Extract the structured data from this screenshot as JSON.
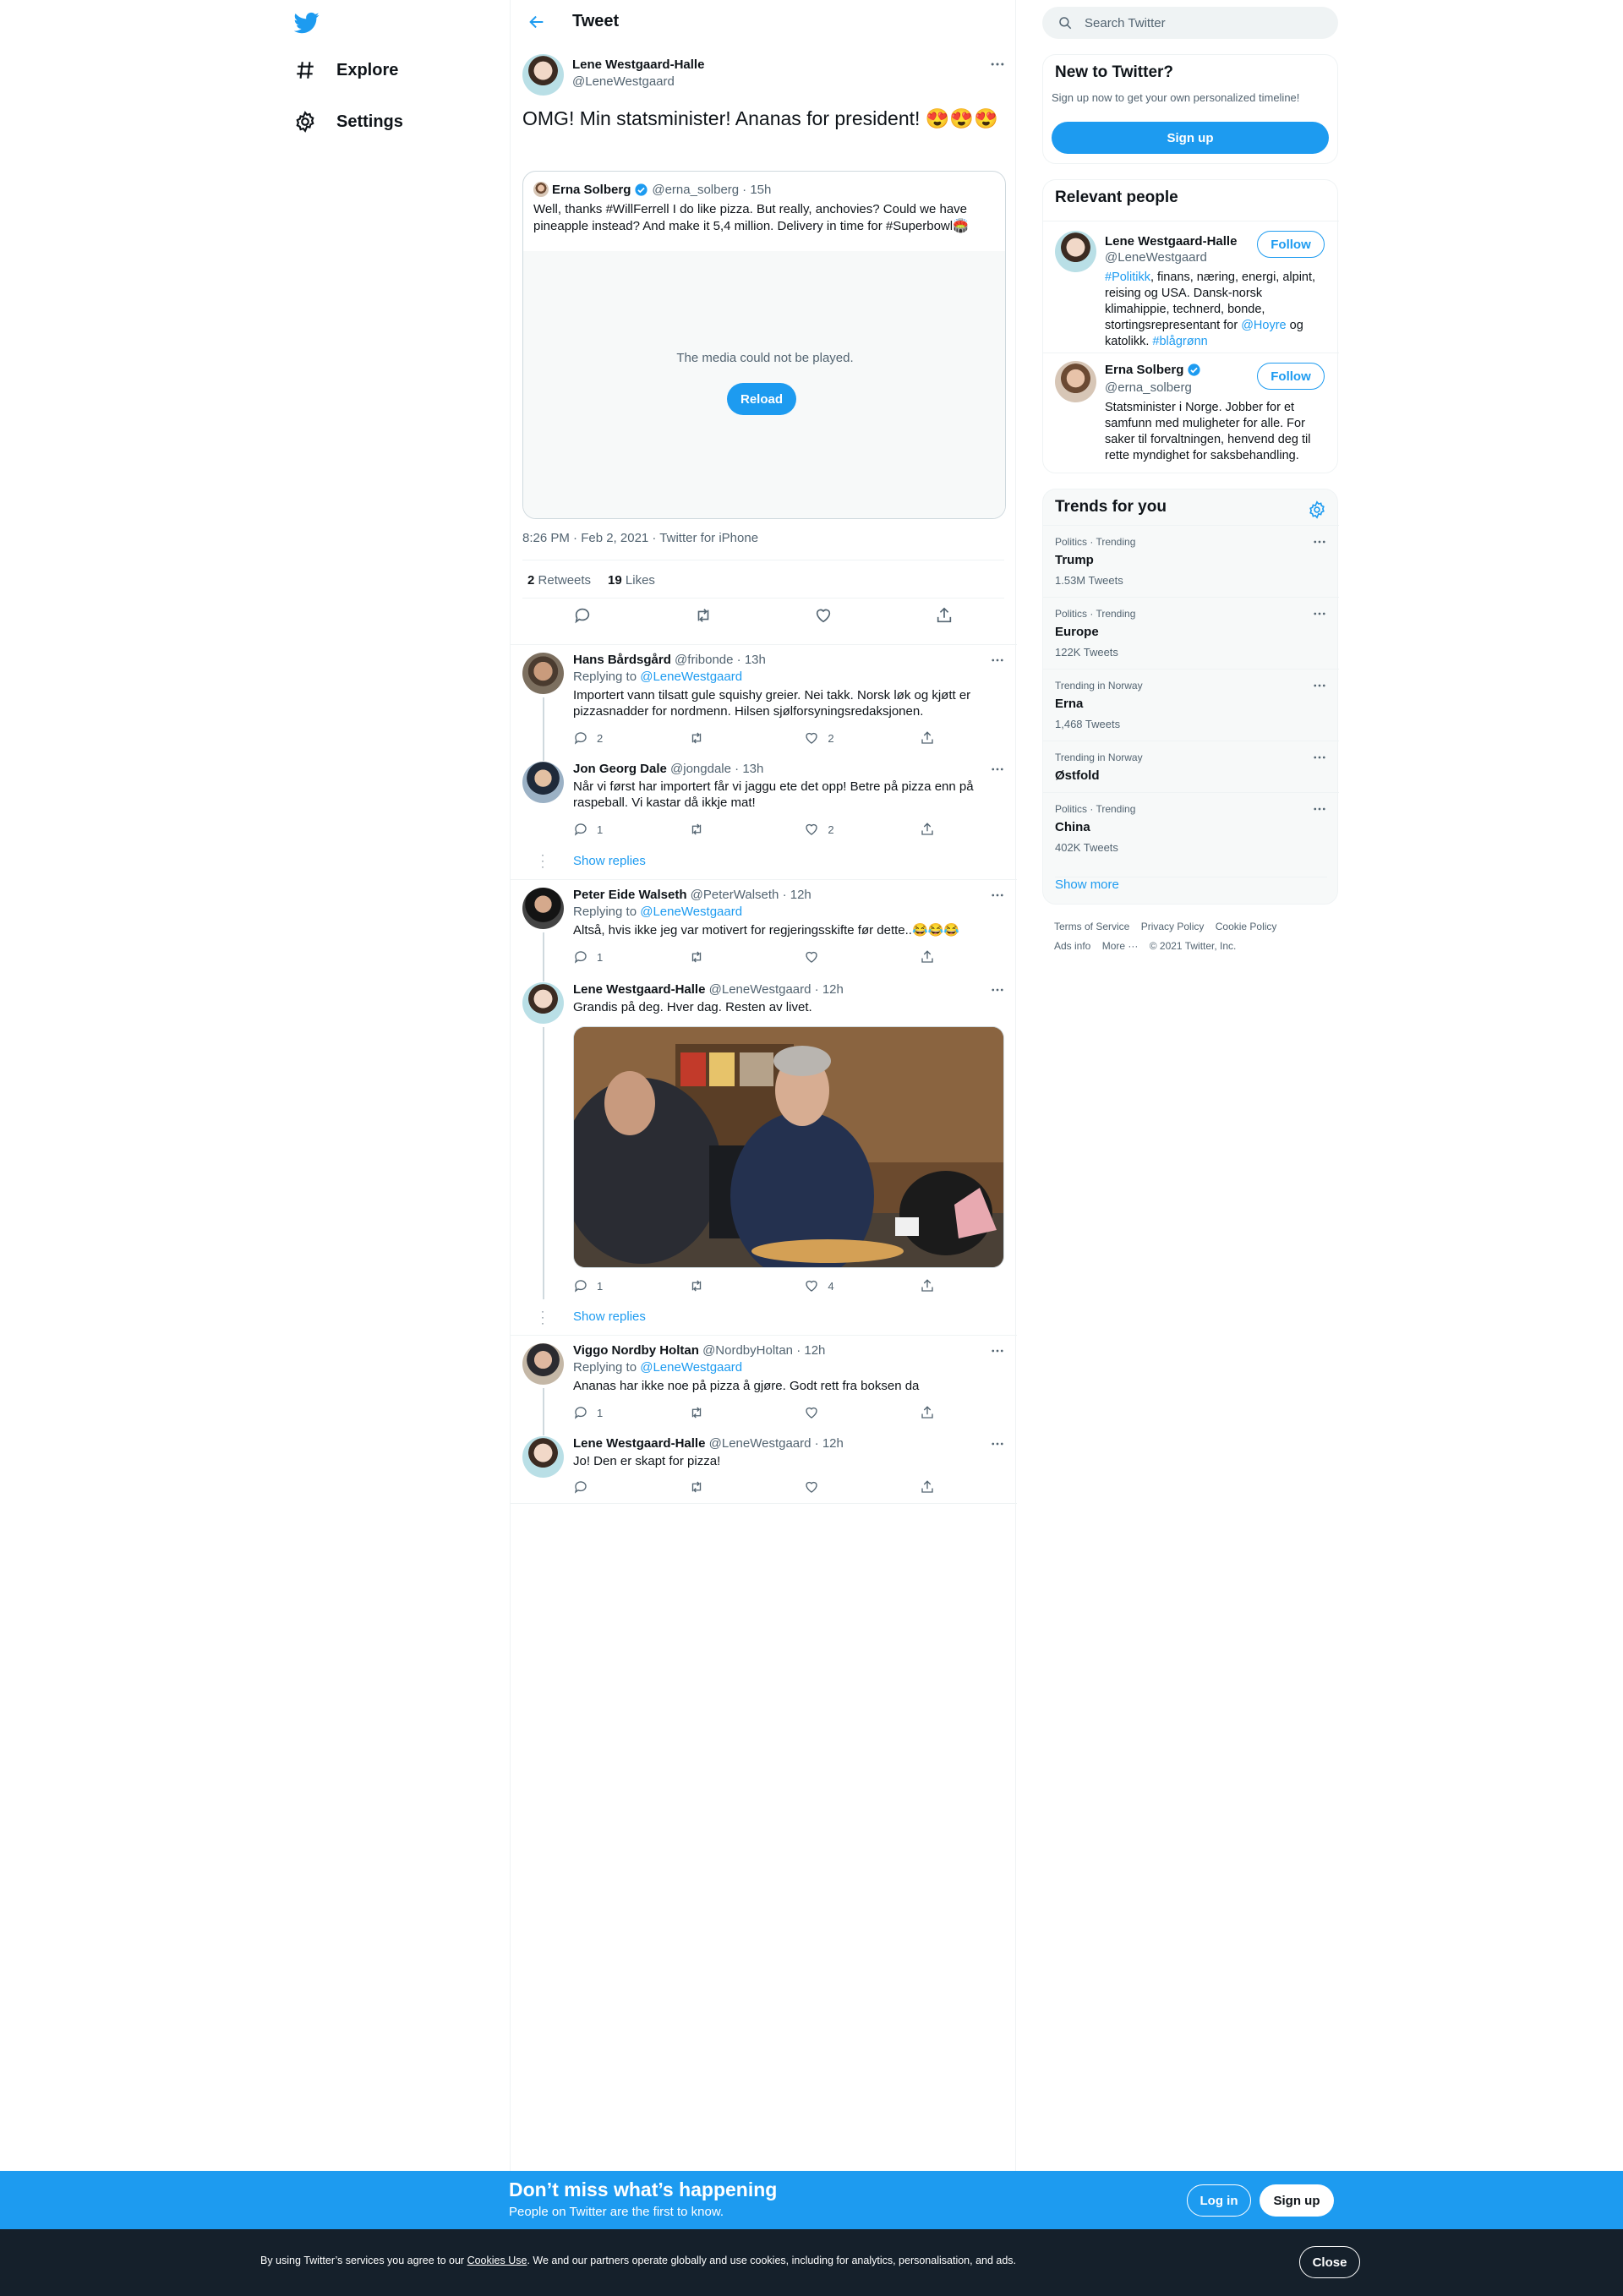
{
  "nav": {
    "explore": "Explore",
    "settings": "Settings"
  },
  "header": {
    "title": "Tweet"
  },
  "tweet": {
    "name": "Lene Westgaard-Halle",
    "handle": "@LeneWestgaard",
    "text": "OMG! Min statsminister! Ananas for president! 😍😍😍",
    "quote": {
      "name": "Erna Solberg",
      "handle": "@erna_solberg",
      "time": "· 15h",
      "text": "Well, thanks #WillFerrell I do like pizza. But really, anchovies? Could we have pineapple instead? And make it 5,4 million. Delivery in time for #Superbowl🏟️",
      "media_msg": "The media could not be played.",
      "reload": "Reload"
    },
    "meta": "8:26 PM · Feb 2, 2021 · Twitter for iPhone",
    "retweets": "2",
    "retweets_label": "Retweets",
    "likes": "19",
    "likes_label": "Likes"
  },
  "replies": [
    {
      "name": "Hans Bårdsgård",
      "handle": "@fribonde",
      "time": "· 13h",
      "replying": "Replying to",
      "mention": "@LeneWestgaard",
      "text": "Importert vann tilsatt gule squishy greier. Nei takk. Norsk løk og kjøtt er pizzasnadder for nordmenn. Hilsen sjølforsyningsredaksjonen.",
      "replies": "2",
      "retweets": "",
      "likes": "2"
    },
    {
      "name": "Jon Georg Dale",
      "handle": "@jongdale",
      "time": "· 13h",
      "text": "Når vi først har importert får vi jaggu ete det opp! Betre på pizza enn på raspeball. Vi kastar då ikkje mat!",
      "replies": "1",
      "retweets": "",
      "likes": "2"
    },
    {
      "name": "Peter Eide Walseth",
      "handle": "@PeterWalseth",
      "time": "· 12h",
      "replying": "Replying to",
      "mention": "@LeneWestgaard",
      "text": "Altså, hvis ikke jeg var motivert for regjeringsskifte før dette..😂😂😂",
      "replies": "1",
      "retweets": "",
      "likes": ""
    },
    {
      "name": "Lene Westgaard-Halle",
      "handle": "@LeneWestgaard",
      "time": "· 12h",
      "text": "Grandis på deg. Hver dag. Resten av livet.",
      "replies": "1",
      "retweets": "",
      "likes": "4"
    },
    {
      "name": "Viggo Nordby Holtan",
      "handle": "@NordbyHoltan",
      "time": "· 12h",
      "replying": "Replying to",
      "mention": "@LeneWestgaard",
      "text": "Ananas har ikke noe på pizza å gjøre. Godt rett fra boksen da",
      "replies": "1",
      "retweets": "",
      "likes": ""
    },
    {
      "name": "Lene Westgaard-Halle",
      "handle": "@LeneWestgaard",
      "time": "· 12h",
      "text": "Jo! Den er skapt for pizza!",
      "replies": "",
      "retweets": "",
      "likes": ""
    }
  ],
  "show_replies": "Show replies",
  "search": {
    "placeholder": "Search Twitter"
  },
  "new_to_twitter": {
    "title": "New to Twitter?",
    "sub": "Sign up now to get your own personalized timeline!",
    "button": "Sign up"
  },
  "relevant": {
    "title": "Relevant people",
    "follow": "Follow",
    "people": [
      {
        "name": "Lene Westgaard-Halle",
        "handle": "@LeneWestgaard",
        "bio_tag1": "#Politikk",
        "bio_a": ", finans, næring, energi, alpint, reising og USA. Dansk-norsk klimahippie, technerd, bonde, stortingsrepresentant for ",
        "bio_tag2": "@Hoyre",
        "bio_b": " og katolikk. ",
        "bio_tag3": "#blågrønn"
      },
      {
        "name": "Erna Solberg",
        "handle": "@erna_solberg",
        "bio": "Statsminister i Norge. Jobber for et samfunn med muligheter for alle. For saker til forvaltningen, henvend deg til rette myndighet for saksbehandling."
      }
    ]
  },
  "trends": {
    "title": "Trends for you",
    "items": [
      {
        "cat": "Politics · Trending",
        "name": "Trump",
        "count": "1.53M Tweets"
      },
      {
        "cat": "Politics · Trending",
        "name": "Europe",
        "count": "122K Tweets"
      },
      {
        "cat": "Trending in Norway",
        "name": "Erna",
        "count": "1,468 Tweets"
      },
      {
        "cat": "Trending in Norway",
        "name": "Østfold",
        "count": ""
      },
      {
        "cat": "Politics · Trending",
        "name": "China",
        "count": "402K Tweets"
      }
    ],
    "show_more": "Show more"
  },
  "footer": {
    "terms": "Terms of Service",
    "privacy": "Privacy Policy",
    "cookie": "Cookie Policy",
    "ads": "Ads info",
    "more": "More ···",
    "copyright": "© 2021 Twitter, Inc."
  },
  "banner": {
    "title": "Don’t miss what’s happening",
    "sub": "People on Twitter are the first to know.",
    "login": "Log in",
    "signup": "Sign up"
  },
  "cookie": {
    "pre": "By using Twitter’s services you agree to our ",
    "link": "Cookies Use",
    "post": ". We and our partners operate globally and use cookies, including for analytics, personalisation, and ads.",
    "close": "Close"
  },
  "colors": {
    "accent": "#1d9bf0",
    "text": "#0f1419",
    "secondary": "#536471",
    "cookie_bg": "#15202b"
  }
}
